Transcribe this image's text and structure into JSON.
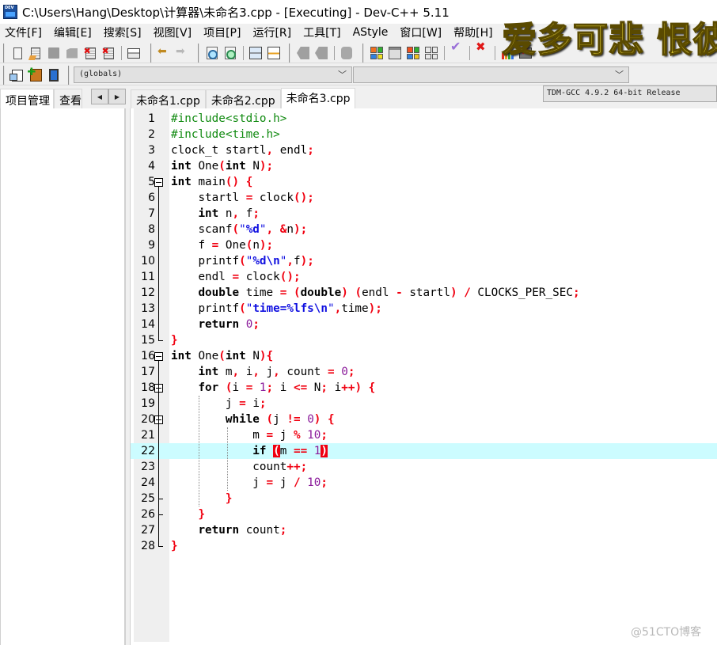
{
  "window": {
    "title": "C:\\Users\\Hang\\Desktop\\计算器\\未命名3.cpp - [Executing] - Dev-C++ 5.11",
    "app_icon": "devcpp-icon"
  },
  "menu": {
    "items": [
      {
        "label": "文件[F]"
      },
      {
        "label": "编辑[E]"
      },
      {
        "label": "搜索[S]"
      },
      {
        "label": "视图[V]"
      },
      {
        "label": "项目[P]"
      },
      {
        "label": "运行[R]"
      },
      {
        "label": "工具[T]"
      },
      {
        "label": "AStyle"
      },
      {
        "label": "窗口[W]"
      },
      {
        "label": "帮助[H]"
      }
    ]
  },
  "toolbar": {
    "compiler": "TDM-GCC 4.9.2 64-bit Release",
    "globals_combo": "(globals)",
    "function_combo": ""
  },
  "overlay_caption": "爱多可悲 恨彼",
  "left_panel": {
    "tabs": [
      {
        "label": "项目管理",
        "active": true
      },
      {
        "label": "查看"
      }
    ]
  },
  "editor": {
    "tabs": [
      {
        "label": "未命名1.cpp",
        "active": false
      },
      {
        "label": "未命名2.cpp",
        "active": false
      },
      {
        "label": "未命名3.cpp",
        "active": true
      }
    ],
    "current_line": 22,
    "lines": [
      "#include<stdio.h>",
      "#include<time.h>",
      "clock_t startl, endl;",
      "int One(int N);",
      "int main() {",
      "    startl = clock();",
      "    int n, f;",
      "    scanf(\"%d\", &n);",
      "    f = One(n);",
      "    printf(\"%d\\n\",f);",
      "    endl = clock();",
      "    double time = (double) (endl - startl) / CLOCKS_PER_SEC;",
      "    printf(\"time=%lfs\\n\",time);",
      "    return 0;",
      "}",
      "int One(int N){",
      "    int m, i, j, count = 0;",
      "    for (i = 1; i <= N; i++) {",
      "        j = i;",
      "        while (j != 0) {",
      "            m = j % 10;",
      "            if (m == 1)",
      "            count++;",
      "            j = j / 10;",
      "        }",
      "    }",
      "    return count;",
      "}"
    ]
  },
  "watermark": "@51CTO博客"
}
